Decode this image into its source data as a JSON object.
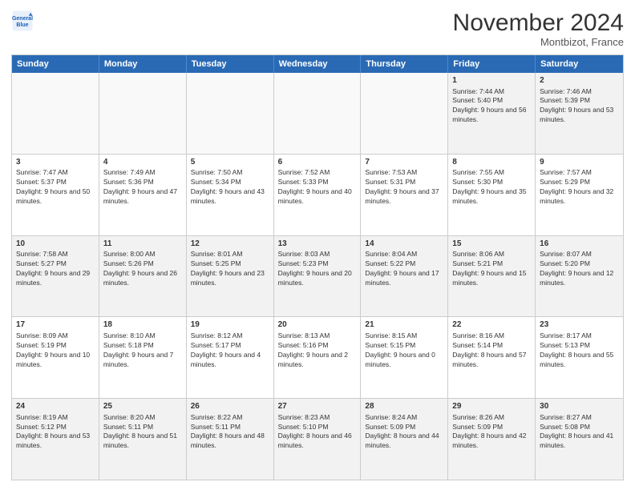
{
  "header": {
    "logo_line1": "General",
    "logo_line2": "Blue",
    "month": "November 2024",
    "location": "Montbizot, France"
  },
  "weekdays": [
    "Sunday",
    "Monday",
    "Tuesday",
    "Wednesday",
    "Thursday",
    "Friday",
    "Saturday"
  ],
  "rows": [
    [
      {
        "day": "",
        "text": ""
      },
      {
        "day": "",
        "text": ""
      },
      {
        "day": "",
        "text": ""
      },
      {
        "day": "",
        "text": ""
      },
      {
        "day": "",
        "text": ""
      },
      {
        "day": "1",
        "text": "Sunrise: 7:44 AM\nSunset: 5:40 PM\nDaylight: 9 hours and 56 minutes."
      },
      {
        "day": "2",
        "text": "Sunrise: 7:46 AM\nSunset: 5:39 PM\nDaylight: 9 hours and 53 minutes."
      }
    ],
    [
      {
        "day": "3",
        "text": "Sunrise: 7:47 AM\nSunset: 5:37 PM\nDaylight: 9 hours and 50 minutes."
      },
      {
        "day": "4",
        "text": "Sunrise: 7:49 AM\nSunset: 5:36 PM\nDaylight: 9 hours and 47 minutes."
      },
      {
        "day": "5",
        "text": "Sunrise: 7:50 AM\nSunset: 5:34 PM\nDaylight: 9 hours and 43 minutes."
      },
      {
        "day": "6",
        "text": "Sunrise: 7:52 AM\nSunset: 5:33 PM\nDaylight: 9 hours and 40 minutes."
      },
      {
        "day": "7",
        "text": "Sunrise: 7:53 AM\nSunset: 5:31 PM\nDaylight: 9 hours and 37 minutes."
      },
      {
        "day": "8",
        "text": "Sunrise: 7:55 AM\nSunset: 5:30 PM\nDaylight: 9 hours and 35 minutes."
      },
      {
        "day": "9",
        "text": "Sunrise: 7:57 AM\nSunset: 5:29 PM\nDaylight: 9 hours and 32 minutes."
      }
    ],
    [
      {
        "day": "10",
        "text": "Sunrise: 7:58 AM\nSunset: 5:27 PM\nDaylight: 9 hours and 29 minutes."
      },
      {
        "day": "11",
        "text": "Sunrise: 8:00 AM\nSunset: 5:26 PM\nDaylight: 9 hours and 26 minutes."
      },
      {
        "day": "12",
        "text": "Sunrise: 8:01 AM\nSunset: 5:25 PM\nDaylight: 9 hours and 23 minutes."
      },
      {
        "day": "13",
        "text": "Sunrise: 8:03 AM\nSunset: 5:23 PM\nDaylight: 9 hours and 20 minutes."
      },
      {
        "day": "14",
        "text": "Sunrise: 8:04 AM\nSunset: 5:22 PM\nDaylight: 9 hours and 17 minutes."
      },
      {
        "day": "15",
        "text": "Sunrise: 8:06 AM\nSunset: 5:21 PM\nDaylight: 9 hours and 15 minutes."
      },
      {
        "day": "16",
        "text": "Sunrise: 8:07 AM\nSunset: 5:20 PM\nDaylight: 9 hours and 12 minutes."
      }
    ],
    [
      {
        "day": "17",
        "text": "Sunrise: 8:09 AM\nSunset: 5:19 PM\nDaylight: 9 hours and 10 minutes."
      },
      {
        "day": "18",
        "text": "Sunrise: 8:10 AM\nSunset: 5:18 PM\nDaylight: 9 hours and 7 minutes."
      },
      {
        "day": "19",
        "text": "Sunrise: 8:12 AM\nSunset: 5:17 PM\nDaylight: 9 hours and 4 minutes."
      },
      {
        "day": "20",
        "text": "Sunrise: 8:13 AM\nSunset: 5:16 PM\nDaylight: 9 hours and 2 minutes."
      },
      {
        "day": "21",
        "text": "Sunrise: 8:15 AM\nSunset: 5:15 PM\nDaylight: 9 hours and 0 minutes."
      },
      {
        "day": "22",
        "text": "Sunrise: 8:16 AM\nSunset: 5:14 PM\nDaylight: 8 hours and 57 minutes."
      },
      {
        "day": "23",
        "text": "Sunrise: 8:17 AM\nSunset: 5:13 PM\nDaylight: 8 hours and 55 minutes."
      }
    ],
    [
      {
        "day": "24",
        "text": "Sunrise: 8:19 AM\nSunset: 5:12 PM\nDaylight: 8 hours and 53 minutes."
      },
      {
        "day": "25",
        "text": "Sunrise: 8:20 AM\nSunset: 5:11 PM\nDaylight: 8 hours and 51 minutes."
      },
      {
        "day": "26",
        "text": "Sunrise: 8:22 AM\nSunset: 5:11 PM\nDaylight: 8 hours and 48 minutes."
      },
      {
        "day": "27",
        "text": "Sunrise: 8:23 AM\nSunset: 5:10 PM\nDaylight: 8 hours and 46 minutes."
      },
      {
        "day": "28",
        "text": "Sunrise: 8:24 AM\nSunset: 5:09 PM\nDaylight: 8 hours and 44 minutes."
      },
      {
        "day": "29",
        "text": "Sunrise: 8:26 AM\nSunset: 5:09 PM\nDaylight: 8 hours and 42 minutes."
      },
      {
        "day": "30",
        "text": "Sunrise: 8:27 AM\nSunset: 5:08 PM\nDaylight: 8 hours and 41 minutes."
      }
    ]
  ]
}
